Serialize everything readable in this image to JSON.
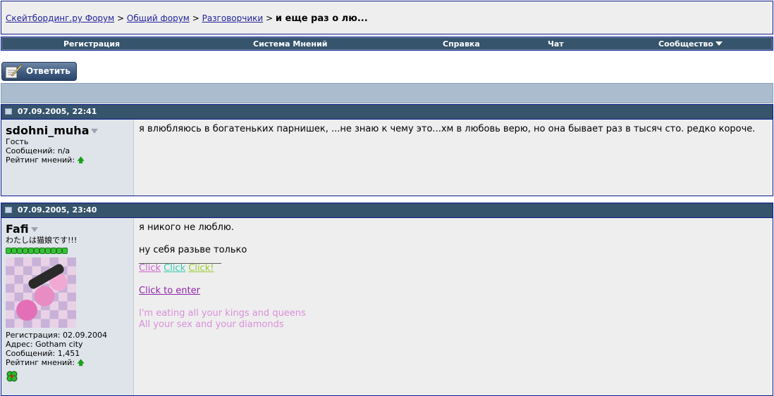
{
  "breadcrumb": {
    "links": [
      "Скейтбординг.ру Форум",
      "Общий форум",
      "Разговорчики"
    ],
    "separator": ">",
    "current": "и еще раз о лю..."
  },
  "navbar": {
    "items": [
      "Регистрация",
      "Система Мнений",
      "Справка",
      "Чат",
      "Сообщество"
    ]
  },
  "reply_button": {
    "label": "Ответить"
  },
  "posts": [
    {
      "date": "07.09.2005, 22:41",
      "username": "sdohni_muha",
      "title": "Гость",
      "posts_label": "Сообщений: n/a",
      "rating_label": "Рейтинг мнений:",
      "message": "я влюбляюсь в богатеньких парнишек, ...не знаю к чему это...хм в любовь верю, но она бывает раз в тысяч сто. редко короче."
    },
    {
      "date": "07.09.2005, 23:40",
      "username": "Fafi",
      "title": "わたしは猫娘です!!!",
      "rep_count": 11,
      "registration": "Регистрация: 02.09.2004",
      "address": "Адрес: Gotham city",
      "posts_label": "Сообщений: 1,451",
      "rating_label": "Рейтинг мнений:",
      "message_line1": "я никого не люблю.",
      "message_line2": "ну себя разьве только",
      "signature_line": "__________________",
      "sig_click1": "Click",
      "sig_click2": "Click",
      "sig_click3": "Click!",
      "sig_enter": "Click to enter",
      "sig_lyric1": "I'm eating all your kings and queens",
      "sig_lyric2": "All your sex and your diamonds"
    }
  ],
  "colors": {
    "nav_bg": "#36546b",
    "link": "#22229C",
    "border": "#0b198c",
    "panel": "#eeeeee",
    "user_panel": "#dfe4ea"
  }
}
